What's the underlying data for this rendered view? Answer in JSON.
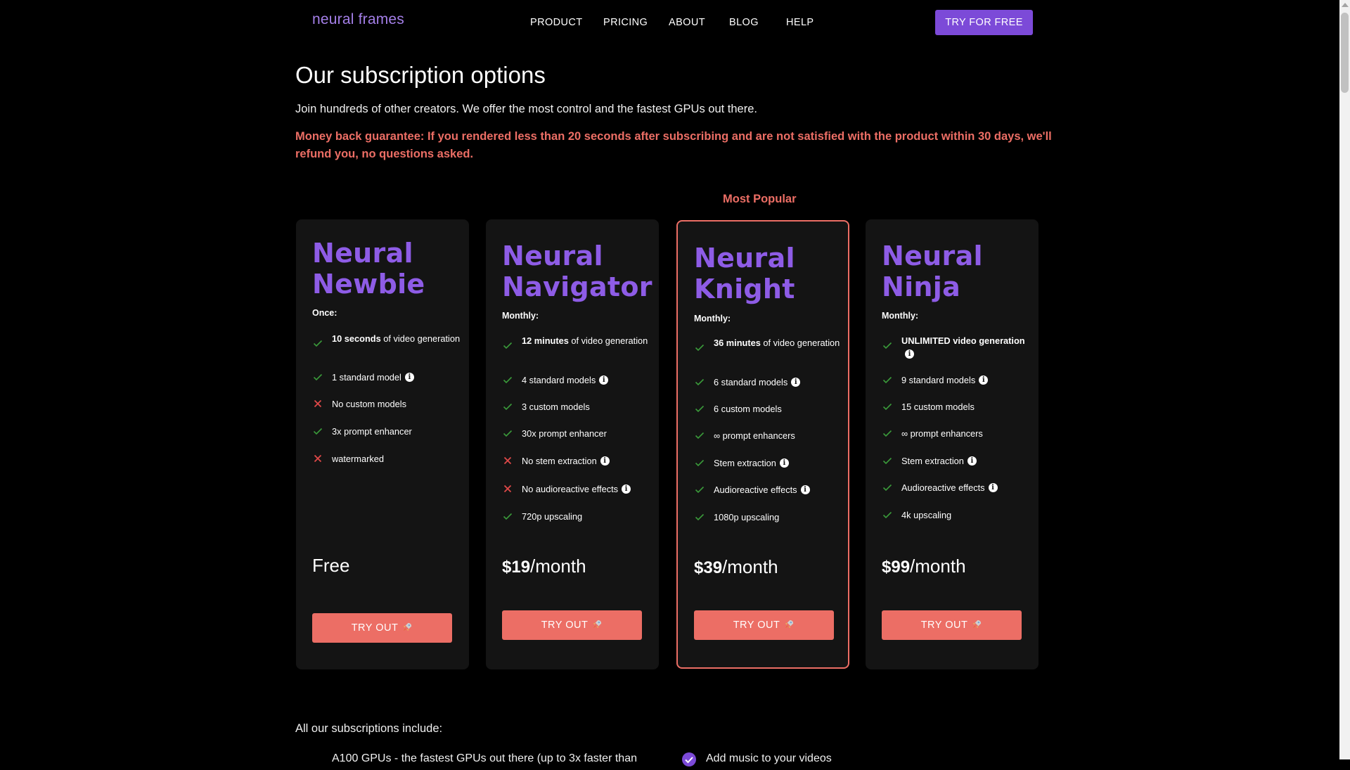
{
  "nav": {
    "logo": "neural frames",
    "links": [
      "PRODUCT",
      "PRICING",
      "ABOUT",
      "BLOG",
      "HELP"
    ],
    "cta": "TRY FOR FREE"
  },
  "page": {
    "title": "Our subscription options",
    "intro": "Join hundreds of other creators. We offer the most control and the fastest GPUs out there.",
    "guarantee": "Money back guarantee: If you rendered less than 20 seconds after subscribing and are not satisfied with the product within 30 days, we'll refund you, no questions asked.",
    "most_popular": "Most Popular"
  },
  "plans": [
    {
      "title_line1": "Neural",
      "title_line2": "Newbie",
      "period": "Once:",
      "features": [
        {
          "bold": "10 seconds",
          "text": " of video generation",
          "ok": true
        },
        {
          "bold": "",
          "text": "1 standard model",
          "ok": true,
          "info": true
        },
        {
          "bold": "",
          "text": "No custom models",
          "ok": false
        },
        {
          "bold": "",
          "text": "3x prompt enhancer",
          "ok": true
        },
        {
          "bold": "",
          "text": "watermarked",
          "ok": false
        }
      ],
      "price_amount": "",
      "price_text": "Free",
      "button": "TRY OUT"
    },
    {
      "title_line1": "Neural",
      "title_line2": "Navigator",
      "period": "Monthly:",
      "features": [
        {
          "bold": "12 minutes",
          "text": " of video generation",
          "ok": true
        },
        {
          "bold": "",
          "text": "4 standard models",
          "ok": true,
          "info": true
        },
        {
          "bold": "",
          "text": "3 custom models",
          "ok": true
        },
        {
          "bold": "",
          "text": "30x prompt enhancer",
          "ok": true
        },
        {
          "bold": "",
          "text": "No stem extraction",
          "ok": false,
          "info": true
        },
        {
          "bold": "",
          "text": "No audioreactive effects",
          "ok": false,
          "info": true
        },
        {
          "bold": "",
          "text": "720p upscaling",
          "ok": true
        }
      ],
      "price_amount": "$19",
      "price_text": "/month",
      "button": "TRY OUT"
    },
    {
      "title_line1": "Neural",
      "title_line2": "Knight",
      "period": "Monthly:",
      "features": [
        {
          "bold": "36 minutes",
          "text": " of video generation",
          "ok": true
        },
        {
          "bold": "",
          "text": "6 standard models",
          "ok": true,
          "info": true
        },
        {
          "bold": "",
          "text": "6 custom models",
          "ok": true
        },
        {
          "bold": "",
          "text": "∞ prompt enhancers",
          "ok": true
        },
        {
          "bold": "",
          "text": "Stem extraction",
          "ok": true,
          "info": true
        },
        {
          "bold": "",
          "text": "Audioreactive effects",
          "ok": true,
          "info": true
        },
        {
          "bold": "",
          "text": "1080p upscaling",
          "ok": true
        }
      ],
      "price_amount": "$39",
      "price_text": "/month",
      "button": "TRY OUT"
    },
    {
      "title_line1": "Neural",
      "title_line2": "Ninja",
      "period": "Monthly:",
      "features": [
        {
          "bold": "UNLIMITED video generation",
          "text": "",
          "ok": true,
          "info": true
        },
        {
          "bold": "",
          "text": "9 standard models",
          "ok": true,
          "info": true
        },
        {
          "bold": "",
          "text": "15 custom models",
          "ok": true
        },
        {
          "bold": "",
          "text": "∞ prompt enhancers",
          "ok": true
        },
        {
          "bold": "",
          "text": "Stem extraction",
          "ok": true,
          "info": true
        },
        {
          "bold": "",
          "text": "Audioreactive effects",
          "ok": true,
          "info": true
        },
        {
          "bold": "",
          "text": "4k upscaling",
          "ok": true
        }
      ],
      "price_amount": "$99",
      "price_text": "/month",
      "button": "TRY OUT"
    }
  ],
  "includes": {
    "heading": "All our subscriptions include:",
    "item1": "A100 GPUs - the fastest GPUs out there (up to 3x faster than",
    "item2": "Add music to your videos"
  },
  "colors": {
    "accent_purple": "#8e5ce6",
    "cta_purple": "#7c4ad8",
    "coral": "#ec6e65",
    "check_green": "#3a8a3a",
    "cross_red": "#e04848"
  }
}
